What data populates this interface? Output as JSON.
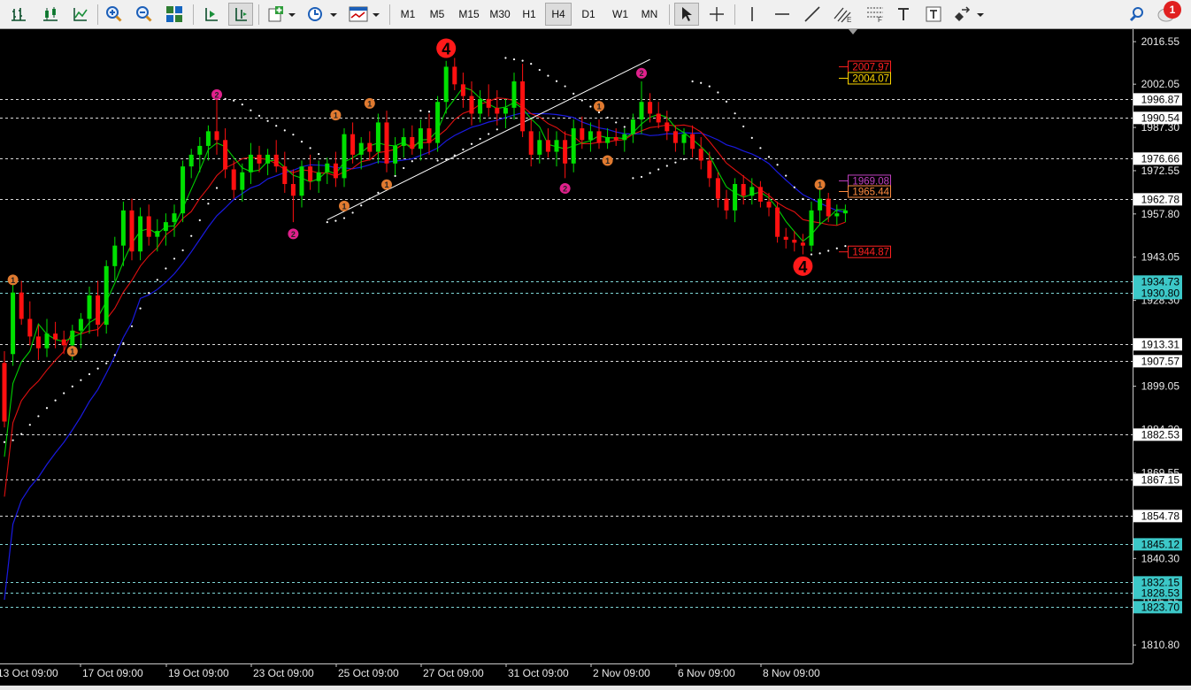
{
  "toolbar": {
    "timeframes": [
      "M1",
      "M5",
      "M15",
      "M30",
      "H1",
      "H4",
      "D1",
      "W1",
      "MN"
    ],
    "active_timeframe": "H4",
    "notification_count": "1"
  },
  "chart_data": {
    "type": "candlestick",
    "symbol_hint": "",
    "ylim": [
      1804.5,
      2020.5
    ],
    "grid": false,
    "background": "#000000",
    "colors": {
      "bull": "#00e000",
      "bear": "#ff1010",
      "ma_fast": "#00d000",
      "ma_mid": "#e01010",
      "ma_slow": "#1a1ae0",
      "psar": "#ffffff",
      "trend": "#ffffff"
    },
    "y_ticks": [
      "2016.55",
      "2002.05",
      "1987.30",
      "1972.55",
      "1957.80",
      "1943.05",
      "1928.30",
      "1913.55",
      "1899.05",
      "1884.30",
      "1869.55",
      "1854.80",
      "1840.30",
      "1825.55",
      "1810.80"
    ],
    "x_labels": [
      "13 Oct 09:00",
      "17 Oct 09:00",
      "19 Oct 09:00",
      "23 Oct 09:00",
      "25 Oct 09:00",
      "27 Oct 09:00",
      "31 Oct 09:00",
      "2 Nov 09:00",
      "6 Nov 09:00",
      "8 Nov 09:00"
    ],
    "levels": [
      {
        "value": 1996.87,
        "label": "1996.87",
        "kind": "white"
      },
      {
        "value": 1990.54,
        "label": "1990.54",
        "kind": "white"
      },
      {
        "value": 1976.66,
        "label": "1976.66",
        "kind": "white"
      },
      {
        "value": 1962.78,
        "label": "1962.78",
        "kind": "white"
      },
      {
        "value": 1934.73,
        "label": "1934.73",
        "kind": "cyan"
      },
      {
        "value": 1930.8,
        "label": "1930.80",
        "kind": "cyan"
      },
      {
        "value": 1913.31,
        "label": "1913.31",
        "kind": "white"
      },
      {
        "value": 1907.57,
        "label": "1907.57",
        "kind": "white"
      },
      {
        "value": 1882.53,
        "label": "1882.53",
        "kind": "white"
      },
      {
        "value": 1867.15,
        "label": "1867.15",
        "kind": "white"
      },
      {
        "value": 1854.78,
        "label": "1854.78",
        "kind": "white"
      },
      {
        "value": 1845.12,
        "label": "1845.12",
        "kind": "cyan"
      },
      {
        "value": 1832.15,
        "label": "1832.15",
        "kind": "cyan"
      },
      {
        "value": 1828.53,
        "label": "1828.53",
        "kind": "cyan"
      },
      {
        "value": 1823.7,
        "label": "1823.70",
        "kind": "cyan"
      }
    ],
    "floating_labels": [
      {
        "value": 2007.97,
        "label": "2007.97",
        "color": "#ff2020"
      },
      {
        "value": 2004.07,
        "label": "2004.07",
        "color": "#ffd700"
      },
      {
        "value": 1969.08,
        "label": "1969.08",
        "color": "#c040c0"
      },
      {
        "value": 1965.44,
        "label": "1965.44",
        "color": "#ff8c40"
      },
      {
        "value": 1944.87,
        "label": "1944.87",
        "color": "#ff2020"
      }
    ],
    "wave_labels": [
      {
        "text": "4",
        "value": 2014.3,
        "bar": 52,
        "size": "big",
        "color": "#ff1a1a"
      },
      {
        "text": "4",
        "value": 1940.0,
        "bar": 94,
        "size": "big",
        "color": "#ff1a1a"
      },
      {
        "text": "2",
        "value": 1998.5,
        "bar": 25,
        "size": "small",
        "color": "#e0208c"
      },
      {
        "text": "2",
        "value": 1951.0,
        "bar": 34,
        "size": "small",
        "color": "#e0208c"
      },
      {
        "text": "2",
        "value": 1966.5,
        "bar": 66,
        "size": "small",
        "color": "#e0208c"
      },
      {
        "text": "2",
        "value": 2005.8,
        "bar": 75,
        "size": "small",
        "color": "#e0208c"
      },
      {
        "text": "1",
        "value": 1935.3,
        "bar": 1,
        "size": "small",
        "color": "#e07a30"
      },
      {
        "text": "1",
        "value": 1911.0,
        "bar": 8,
        "size": "small",
        "color": "#e07a30"
      },
      {
        "text": "1",
        "value": 1991.5,
        "bar": 39,
        "size": "small",
        "color": "#e07a30"
      },
      {
        "text": "1",
        "value": 1960.5,
        "bar": 40,
        "size": "small",
        "color": "#e07a30"
      },
      {
        "text": "1",
        "value": 1995.5,
        "bar": 43,
        "size": "small",
        "color": "#e07a30"
      },
      {
        "text": "1",
        "value": 1967.8,
        "bar": 45,
        "size": "small",
        "color": "#e07a30"
      },
      {
        "text": "1",
        "value": 1994.5,
        "bar": 70,
        "size": "small",
        "color": "#e07a30"
      },
      {
        "text": "1",
        "value": 1976.0,
        "bar": 71,
        "size": "small",
        "color": "#e07a30"
      },
      {
        "text": "1",
        "value": 1967.8,
        "bar": 96,
        "size": "small",
        "color": "#e07a30"
      }
    ],
    "trendline": {
      "from": [
        38,
        1955.8
      ],
      "to": [
        76,
        2010.5
      ]
    },
    "candles": [
      {
        "o": 1907.0,
        "h": 1911.0,
        "l": 1885.0,
        "c": 1887.0
      },
      {
        "o": 1910.0,
        "h": 1934.0,
        "l": 1906.0,
        "c": 1931.0
      },
      {
        "o": 1931.0,
        "h": 1935.0,
        "l": 1920.0,
        "c": 1922.0
      },
      {
        "o": 1922.0,
        "h": 1928.0,
        "l": 1913.0,
        "c": 1916.0
      },
      {
        "o": 1916.0,
        "h": 1920.0,
        "l": 1908.0,
        "c": 1912.0
      },
      {
        "o": 1912.0,
        "h": 1922.0,
        "l": 1909.0,
        "c": 1917.0
      },
      {
        "o": 1917.0,
        "h": 1921.0,
        "l": 1912.0,
        "c": 1915.0
      },
      {
        "o": 1915.0,
        "h": 1918.0,
        "l": 1910.0,
        "c": 1913.0
      },
      {
        "o": 1913.0,
        "h": 1920.0,
        "l": 1908.0,
        "c": 1918.0
      },
      {
        "o": 1918.0,
        "h": 1924.0,
        "l": 1912.0,
        "c": 1922.0
      },
      {
        "o": 1922.0,
        "h": 1933.0,
        "l": 1917.0,
        "c": 1930.0
      },
      {
        "o": 1930.0,
        "h": 1935.0,
        "l": 1916.0,
        "c": 1920.0
      },
      {
        "o": 1920.0,
        "h": 1942.0,
        "l": 1917.0,
        "c": 1940.0
      },
      {
        "o": 1940.0,
        "h": 1950.0,
        "l": 1935.0,
        "c": 1947.0
      },
      {
        "o": 1947.0,
        "h": 1962.0,
        "l": 1940.0,
        "c": 1959.0
      },
      {
        "o": 1959.0,
        "h": 1963.0,
        "l": 1942.0,
        "c": 1945.0
      },
      {
        "o": 1945.0,
        "h": 1960.0,
        "l": 1942.0,
        "c": 1957.0
      },
      {
        "o": 1957.0,
        "h": 1961.0,
        "l": 1947.0,
        "c": 1950.0
      },
      {
        "o": 1950.0,
        "h": 1956.0,
        "l": 1945.0,
        "c": 1952.0
      },
      {
        "o": 1952.0,
        "h": 1958.0,
        "l": 1947.0,
        "c": 1955.0
      },
      {
        "o": 1955.0,
        "h": 1961.0,
        "l": 1950.0,
        "c": 1958.0
      },
      {
        "o": 1958.0,
        "h": 1976.0,
        "l": 1955.0,
        "c": 1974.0
      },
      {
        "o": 1974.0,
        "h": 1980.0,
        "l": 1970.0,
        "c": 1978.0
      },
      {
        "o": 1978.0,
        "h": 1984.0,
        "l": 1972.0,
        "c": 1981.0
      },
      {
        "o": 1981.0,
        "h": 1988.0,
        "l": 1976.0,
        "c": 1986.0
      },
      {
        "o": 1986.0,
        "h": 1997.0,
        "l": 1978.0,
        "c": 1983.0
      },
      {
        "o": 1983.0,
        "h": 1987.0,
        "l": 1970.0,
        "c": 1973.0
      },
      {
        "o": 1973.0,
        "h": 1976.0,
        "l": 1963.0,
        "c": 1966.0
      },
      {
        "o": 1966.0,
        "h": 1975.0,
        "l": 1962.0,
        "c": 1972.0
      },
      {
        "o": 1972.0,
        "h": 1982.0,
        "l": 1968.0,
        "c": 1978.0
      },
      {
        "o": 1978.0,
        "h": 1981.0,
        "l": 1972.0,
        "c": 1975.0
      },
      {
        "o": 1975.0,
        "h": 1980.0,
        "l": 1971.0,
        "c": 1978.0
      },
      {
        "o": 1978.0,
        "h": 1983.0,
        "l": 1972.0,
        "c": 1974.0
      },
      {
        "o": 1974.0,
        "h": 1979.0,
        "l": 1965.0,
        "c": 1968.0
      },
      {
        "o": 1968.0,
        "h": 1973.0,
        "l": 1955.0,
        "c": 1964.0
      },
      {
        "o": 1964.0,
        "h": 1976.0,
        "l": 1960.0,
        "c": 1974.0
      },
      {
        "o": 1974.0,
        "h": 1978.0,
        "l": 1966.0,
        "c": 1969.0
      },
      {
        "o": 1969.0,
        "h": 1976.0,
        "l": 1965.0,
        "c": 1972.0
      },
      {
        "o": 1972.0,
        "h": 1977.0,
        "l": 1968.0,
        "c": 1975.0
      },
      {
        "o": 1975.0,
        "h": 1979.0,
        "l": 1967.0,
        "c": 1970.0
      },
      {
        "o": 1970.0,
        "h": 1987.0,
        "l": 1967.0,
        "c": 1985.0
      },
      {
        "o": 1985.0,
        "h": 1989.0,
        "l": 1975.0,
        "c": 1978.0
      },
      {
        "o": 1978.0,
        "h": 1984.0,
        "l": 1973.0,
        "c": 1982.0
      },
      {
        "o": 1982.0,
        "h": 1986.0,
        "l": 1976.0,
        "c": 1979.0
      },
      {
        "o": 1979.0,
        "h": 1992.0,
        "l": 1975.0,
        "c": 1989.0
      },
      {
        "o": 1989.0,
        "h": 1993.0,
        "l": 1972.0,
        "c": 1975.0
      },
      {
        "o": 1975.0,
        "h": 1984.0,
        "l": 1971.0,
        "c": 1981.0
      },
      {
        "o": 1981.0,
        "h": 1987.0,
        "l": 1977.0,
        "c": 1984.0
      },
      {
        "o": 1984.0,
        "h": 1988.0,
        "l": 1978.0,
        "c": 1980.0
      },
      {
        "o": 1980.0,
        "h": 1990.0,
        "l": 1976.0,
        "c": 1987.0
      },
      {
        "o": 1987.0,
        "h": 1992.0,
        "l": 1978.0,
        "c": 1982.0
      },
      {
        "o": 1982.0,
        "h": 1998.0,
        "l": 1979.0,
        "c": 1996.0
      },
      {
        "o": 1996.0,
        "h": 2010.0,
        "l": 1992.0,
        "c": 2008.0
      },
      {
        "o": 2008.0,
        "h": 2011.0,
        "l": 2000.0,
        "c": 2002.0
      },
      {
        "o": 2002.0,
        "h": 2006.0,
        "l": 1994.0,
        "c": 1998.0
      },
      {
        "o": 1998.0,
        "h": 2003.0,
        "l": 1988.0,
        "c": 1992.0
      },
      {
        "o": 1992.0,
        "h": 2000.0,
        "l": 1989.0,
        "c": 1997.0
      },
      {
        "o": 1997.0,
        "h": 2002.0,
        "l": 1991.0,
        "c": 1994.0
      },
      {
        "o": 1994.0,
        "h": 2000.0,
        "l": 1988.0,
        "c": 1992.0
      },
      {
        "o": 1992.0,
        "h": 1997.0,
        "l": 1987.0,
        "c": 1994.0
      },
      {
        "o": 1994.0,
        "h": 2006.0,
        "l": 1990.0,
        "c": 2003.0
      },
      {
        "o": 2003.0,
        "h": 2009.0,
        "l": 1984.0,
        "c": 1986.0
      },
      {
        "o": 1986.0,
        "h": 1990.0,
        "l": 1974.0,
        "c": 1978.0
      },
      {
        "o": 1978.0,
        "h": 1986.0,
        "l": 1975.0,
        "c": 1983.0
      },
      {
        "o": 1983.0,
        "h": 1987.0,
        "l": 1977.0,
        "c": 1979.0
      },
      {
        "o": 1979.0,
        "h": 1986.0,
        "l": 1974.0,
        "c": 1983.0
      },
      {
        "o": 1983.0,
        "h": 1986.0,
        "l": 1970.0,
        "c": 1975.0
      },
      {
        "o": 1975.0,
        "h": 1990.0,
        "l": 1972.0,
        "c": 1987.0
      },
      {
        "o": 1987.0,
        "h": 1991.0,
        "l": 1980.0,
        "c": 1983.0
      },
      {
        "o": 1983.0,
        "h": 1989.0,
        "l": 1979.0,
        "c": 1986.0
      },
      {
        "o": 1986.0,
        "h": 1990.0,
        "l": 1980.0,
        "c": 1982.0
      },
      {
        "o": 1982.0,
        "h": 1987.0,
        "l": 1980.0,
        "c": 1984.0
      },
      {
        "o": 1984.0,
        "h": 1987.0,
        "l": 1981.0,
        "c": 1983.0
      },
      {
        "o": 1983.0,
        "h": 1987.0,
        "l": 1979.0,
        "c": 1985.0
      },
      {
        "o": 1985.0,
        "h": 1992.0,
        "l": 1982.0,
        "c": 1990.0
      },
      {
        "o": 1990.0,
        "h": 2003.0,
        "l": 1985.0,
        "c": 1996.0
      },
      {
        "o": 1996.0,
        "h": 1999.0,
        "l": 1989.0,
        "c": 1992.0
      },
      {
        "o": 1992.0,
        "h": 1996.0,
        "l": 1987.0,
        "c": 1989.0
      },
      {
        "o": 1989.0,
        "h": 1993.0,
        "l": 1983.0,
        "c": 1986.0
      },
      {
        "o": 1986.0,
        "h": 1988.0,
        "l": 1979.0,
        "c": 1982.0
      },
      {
        "o": 1982.0,
        "h": 1987.0,
        "l": 1978.0,
        "c": 1985.0
      },
      {
        "o": 1985.0,
        "h": 1988.0,
        "l": 1977.0,
        "c": 1980.0
      },
      {
        "o": 1980.0,
        "h": 1984.0,
        "l": 1973.0,
        "c": 1976.0
      },
      {
        "o": 1976.0,
        "h": 1979.0,
        "l": 1967.0,
        "c": 1970.0
      },
      {
        "o": 1970.0,
        "h": 1972.0,
        "l": 1960.0,
        "c": 1963.0
      },
      {
        "o": 1963.0,
        "h": 1966.0,
        "l": 1956.0,
        "c": 1959.0
      },
      {
        "o": 1959.0,
        "h": 1970.0,
        "l": 1955.0,
        "c": 1968.0
      },
      {
        "o": 1968.0,
        "h": 1971.0,
        "l": 1961.0,
        "c": 1964.0
      },
      {
        "o": 1964.0,
        "h": 1970.0,
        "l": 1961.0,
        "c": 1967.0
      },
      {
        "o": 1967.0,
        "h": 1969.0,
        "l": 1960.0,
        "c": 1962.0
      },
      {
        "o": 1962.0,
        "h": 1965.0,
        "l": 1957.0,
        "c": 1960.0
      },
      {
        "o": 1960.0,
        "h": 1962.0,
        "l": 1948.0,
        "c": 1950.0
      },
      {
        "o": 1950.0,
        "h": 1953.0,
        "l": 1946.0,
        "c": 1949.0
      },
      {
        "o": 1949.0,
        "h": 1952.0,
        "l": 1945.0,
        "c": 1948.0
      },
      {
        "o": 1948.0,
        "h": 1951.0,
        "l": 1944.0,
        "c": 1947.0
      },
      {
        "o": 1947.0,
        "h": 1962.0,
        "l": 1945.0,
        "c": 1959.0
      },
      {
        "o": 1959.0,
        "h": 1966.0,
        "l": 1954.0,
        "c": 1963.0
      },
      {
        "o": 1963.0,
        "h": 1965.0,
        "l": 1955.0,
        "c": 1957.0
      },
      {
        "o": 1957.0,
        "h": 1961.0,
        "l": 1954.0,
        "c": 1958.0
      },
      {
        "o": 1958.0,
        "h": 1961.0,
        "l": 1955.0,
        "c": 1959.0
      }
    ]
  }
}
